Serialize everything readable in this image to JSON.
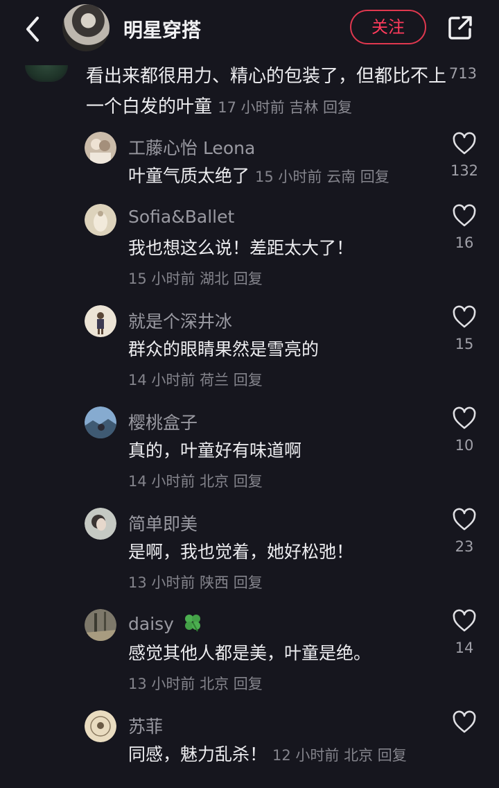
{
  "header": {
    "title": "明星穿搭",
    "follow_label": "关注"
  },
  "top_comment": {
    "text": "看出来都很用力、精心的包装了，但都比不上一个白发的叶童",
    "meta": "17 小时前  吉林  回复",
    "likes": "713"
  },
  "replies": [
    {
      "name": "工藤心怡 Leona",
      "text": "叶童气质太绝了",
      "meta": "15 小时前  云南  回复",
      "likes": "132",
      "avatar_color": "#c9b8a6"
    },
    {
      "name": "Sofia&Ballet",
      "text": "我也想这么说！差距太大了！",
      "meta": "15 小时前  湖北  回复",
      "likes": "16",
      "avatar_color": "#d8cdb4"
    },
    {
      "name": "就是个深井冰",
      "text": "群众的眼睛果然是雪亮的",
      "meta": "14 小时前  荷兰  回复",
      "likes": "15",
      "avatar_color": "#e6ddd0"
    },
    {
      "name": "樱桃盒子",
      "text": "真的，叶童好有味道啊",
      "meta": "14 小时前  北京  回复",
      "likes": "10",
      "avatar_color": "#7fa3c8"
    },
    {
      "name": "简单即美",
      "text": "是啊，我也觉着，她好松弛！",
      "meta": "13 小时前  陕西  回复",
      "likes": "23",
      "avatar_color": "#b9bdb8"
    },
    {
      "name": "daisy",
      "text": "感觉其他人都是美，叶童是绝。",
      "meta": "13 小时前  北京  回复",
      "likes": "14",
      "avatar_color": "#6e6a5e"
    },
    {
      "name": "苏菲",
      "text": "同感，魅力乱杀！",
      "meta": "12 小时前  北京  回复",
      "likes": "",
      "avatar_color": "#e9dcc0"
    }
  ],
  "colors": {
    "background": "#16161e",
    "accent": "#ff3b5c"
  }
}
